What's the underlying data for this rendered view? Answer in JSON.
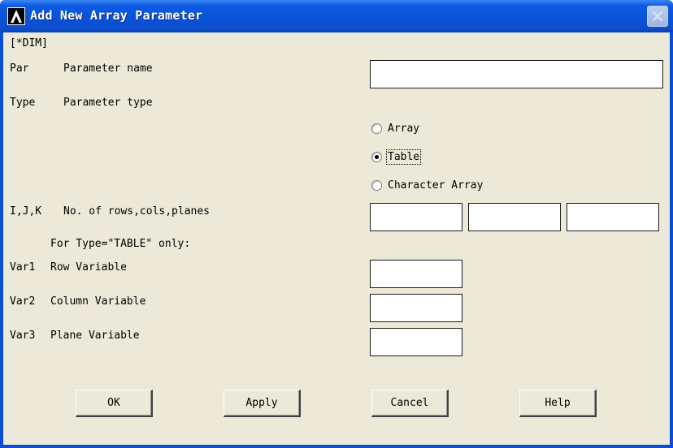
{
  "window": {
    "title": "Add New Array Parameter",
    "command": "[*DIM]"
  },
  "fields": {
    "par_code": "Par",
    "par_label": "Parameter name",
    "par_value": "",
    "type_code": "Type",
    "type_label": "Parameter type",
    "ijk_code": "I,J,K",
    "ijk_label": "No. of rows,cols,planes",
    "ijk_values": [
      "",
      "",
      ""
    ],
    "table_note": "For Type=\"TABLE\" only:",
    "var1_code": "Var1",
    "var1_label": "Row Variable",
    "var1_value": "",
    "var2_code": "Var2",
    "var2_label": "Column Variable",
    "var2_value": "",
    "var3_code": "Var3",
    "var3_label": "Plane Variable",
    "var3_value": ""
  },
  "type_options": [
    {
      "label": "Array",
      "checked": false
    },
    {
      "label": "Table",
      "checked": true
    },
    {
      "label": "Character Array",
      "checked": false
    }
  ],
  "buttons": {
    "ok": "OK",
    "apply": "Apply",
    "cancel": "Cancel",
    "help": "Help"
  },
  "colors": {
    "titlebar": "#0a52d8",
    "dialog_bg": "#ece9d8"
  }
}
